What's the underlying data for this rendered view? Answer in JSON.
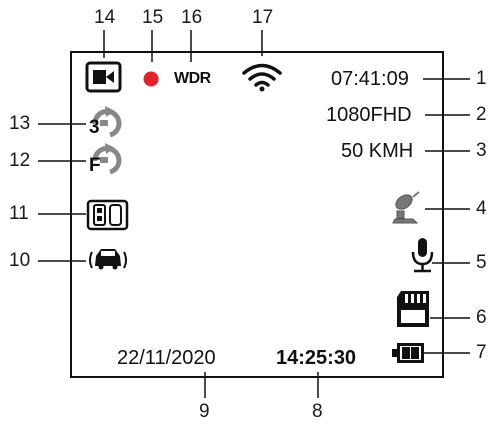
{
  "screen": {
    "time": "07:41:09",
    "resolution": "1080FHD",
    "speed": "50 KMH",
    "date": "22/11/2020",
    "timestamp": "14:25:30",
    "wdr": "WDR",
    "loop_3_label": "3",
    "loop_f_label": "F"
  },
  "callouts": [
    "1",
    "2",
    "3",
    "4",
    "5",
    "6",
    "7",
    "8",
    "9",
    "10",
    "11",
    "12",
    "13",
    "14",
    "15",
    "16",
    "17"
  ],
  "colors": {
    "record_dot": "#e8202a",
    "ink": "#111111"
  },
  "icons": [
    "video-camera-icon",
    "record-dot-icon",
    "wifi-icon",
    "gps-satellite-icon",
    "microphone-icon",
    "sd-card-icon",
    "battery-icon",
    "car-collision-icon",
    "parking-mode-icon",
    "loop-recording-f-icon",
    "loop-recording-3-icon"
  ]
}
